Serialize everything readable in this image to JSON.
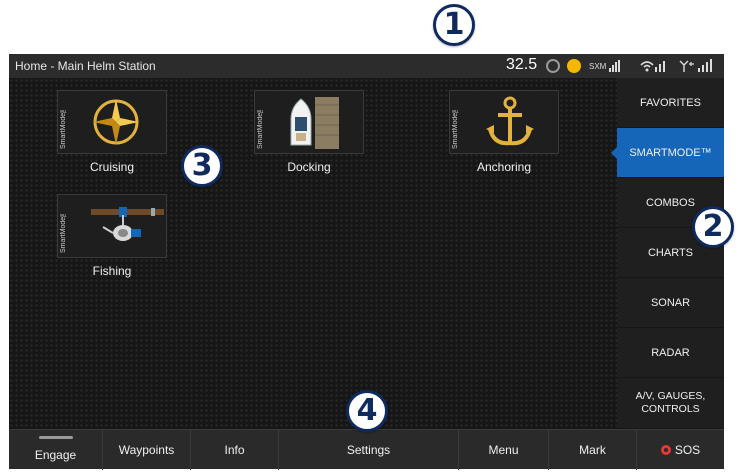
{
  "callouts": [
    "1",
    "2",
    "3",
    "4"
  ],
  "status": {
    "title": "Home - Main Helm Station",
    "reading": "32.5",
    "sxm_label": "SXM"
  },
  "tiles": [
    {
      "label": "Cruising",
      "tag": "SmartMode™",
      "icon": "compass-rose-icon"
    },
    {
      "label": "Docking",
      "tag": "SmartMode™",
      "icon": "boat-dock-icon"
    },
    {
      "label": "Anchoring",
      "tag": "SmartMode™",
      "icon": "anchor-icon"
    },
    {
      "label": "Fishing",
      "tag": "SmartMode™",
      "icon": "fishing-reel-icon"
    }
  ],
  "sidebar": [
    {
      "label": "FAVORITES"
    },
    {
      "label": "SMARTMODE™",
      "active": true
    },
    {
      "label": "COMBOS"
    },
    {
      "label": "CHARTS"
    },
    {
      "label": "SONAR"
    },
    {
      "label": "RADAR"
    },
    {
      "label": "A/V, GAUGES, CONTROLS"
    }
  ],
  "bottom": {
    "engage": "Engage",
    "waypoints": "Waypoints",
    "info": "Info",
    "settings": "Settings",
    "menu": "Menu",
    "mark": "Mark",
    "sos": "SOS"
  },
  "colors": {
    "accent": "#1565b8",
    "alert": "#f5b800",
    "sos": "#e53935",
    "callout": "#0f2a5e"
  }
}
